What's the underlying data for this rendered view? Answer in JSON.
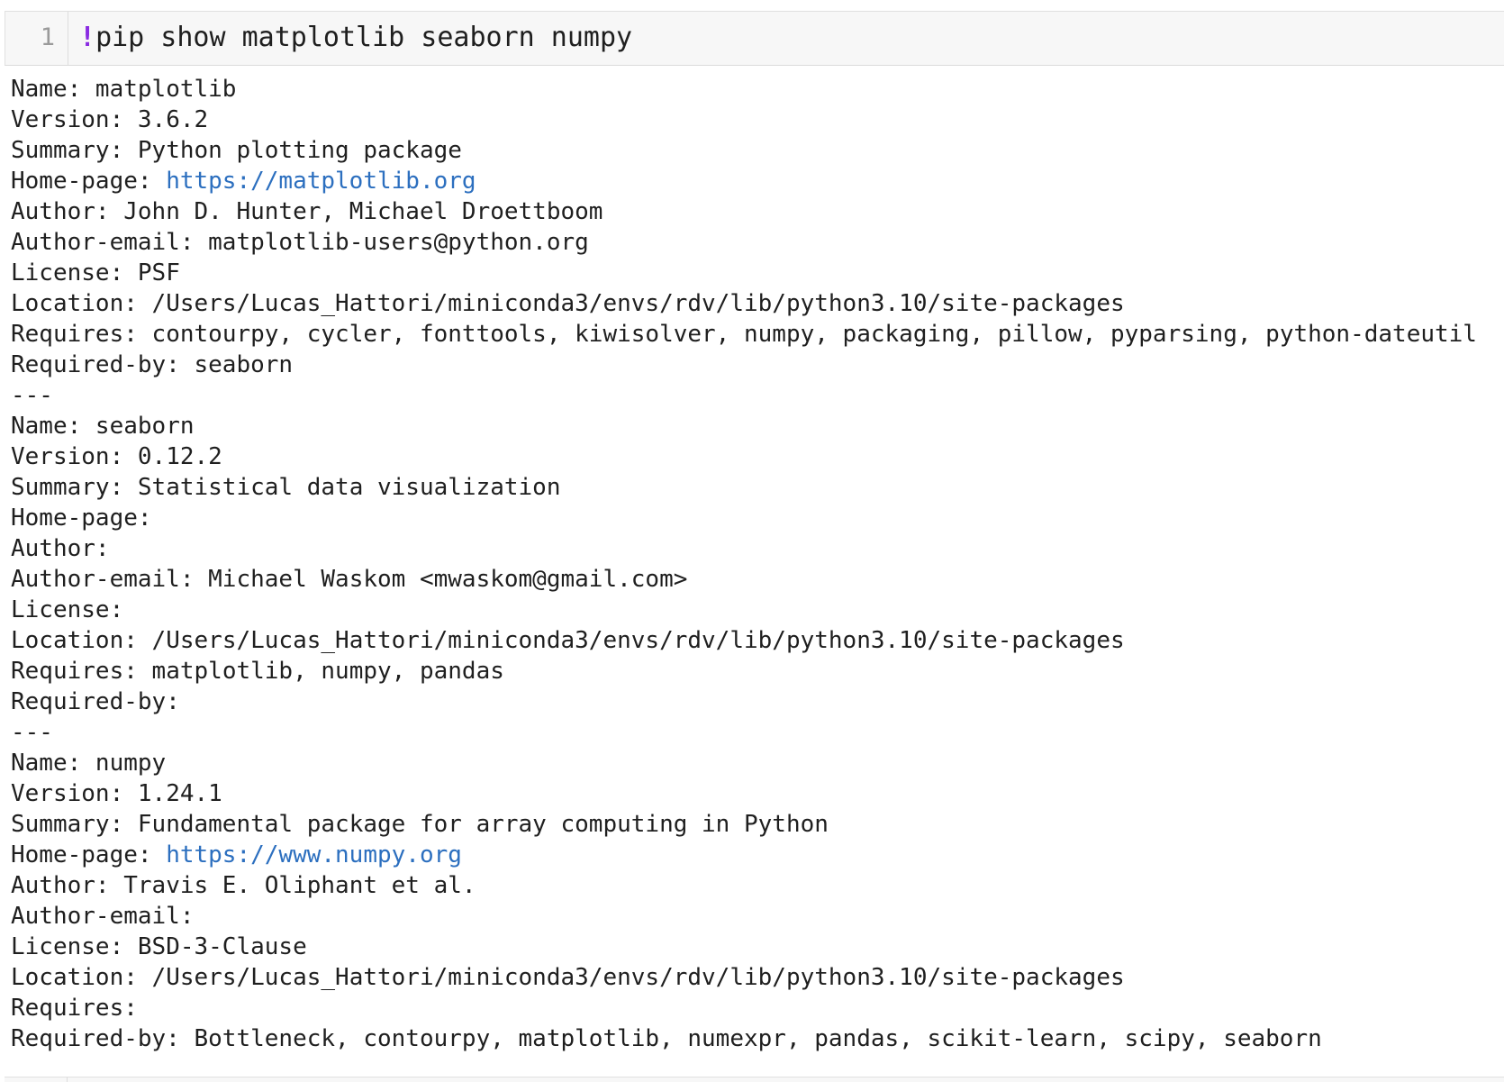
{
  "input_cell": {
    "line_number": "1",
    "bang": "!",
    "command": "pip show matplotlib seaborn numpy"
  },
  "output": {
    "lines": [
      {
        "label": "Name: ",
        "value": "matplotlib",
        "link": ""
      },
      {
        "label": "Version: ",
        "value": "3.6.2",
        "link": ""
      },
      {
        "label": "Summary: ",
        "value": "Python plotting package",
        "link": ""
      },
      {
        "label": "Home-page: ",
        "value": "",
        "link": "https://matplotlib.org"
      },
      {
        "label": "Author: ",
        "value": "John D. Hunter, Michael Droettboom",
        "link": ""
      },
      {
        "label": "Author-email: ",
        "value": "matplotlib-users@python.org",
        "link": ""
      },
      {
        "label": "License: ",
        "value": "PSF",
        "link": ""
      },
      {
        "label": "Location: ",
        "value": "/Users/Lucas_Hattori/miniconda3/envs/rdv/lib/python3.10/site-packages",
        "link": ""
      },
      {
        "label": "Requires: ",
        "value": "contourpy, cycler, fonttools, kiwisolver, numpy, packaging, pillow, pyparsing, python-dateutil",
        "link": ""
      },
      {
        "label": "Required-by: ",
        "value": "seaborn",
        "link": ""
      },
      {
        "label": "---",
        "value": "",
        "link": ""
      },
      {
        "label": "Name: ",
        "value": "seaborn",
        "link": ""
      },
      {
        "label": "Version: ",
        "value": "0.12.2",
        "link": ""
      },
      {
        "label": "Summary: ",
        "value": "Statistical data visualization",
        "link": ""
      },
      {
        "label": "Home-page:",
        "value": "",
        "link": ""
      },
      {
        "label": "Author:",
        "value": "",
        "link": ""
      },
      {
        "label": "Author-email: ",
        "value": "Michael Waskom <mwaskom@gmail.com>",
        "link": ""
      },
      {
        "label": "License:",
        "value": "",
        "link": ""
      },
      {
        "label": "Location: ",
        "value": "/Users/Lucas_Hattori/miniconda3/envs/rdv/lib/python3.10/site-packages",
        "link": ""
      },
      {
        "label": "Requires: ",
        "value": "matplotlib, numpy, pandas",
        "link": ""
      },
      {
        "label": "Required-by:",
        "value": "",
        "link": ""
      },
      {
        "label": "---",
        "value": "",
        "link": ""
      },
      {
        "label": "Name: ",
        "value": "numpy",
        "link": ""
      },
      {
        "label": "Version: ",
        "value": "1.24.1",
        "link": ""
      },
      {
        "label": "Summary: ",
        "value": "Fundamental package for array computing in Python",
        "link": ""
      },
      {
        "label": "Home-page: ",
        "value": "",
        "link": "https://www.numpy.org"
      },
      {
        "label": "Author: ",
        "value": "Travis E. Oliphant et al.",
        "link": ""
      },
      {
        "label": "Author-email:",
        "value": "",
        "link": ""
      },
      {
        "label": "License: ",
        "value": "BSD-3-Clause",
        "link": ""
      },
      {
        "label": "Location: ",
        "value": "/Users/Lucas_Hattori/miniconda3/envs/rdv/lib/python3.10/site-packages",
        "link": ""
      },
      {
        "label": "Requires:",
        "value": "",
        "link": ""
      },
      {
        "label": "Required-by: ",
        "value": "Bottleneck, contourpy, matplotlib, numexpr, pandas, scikit-learn, scipy, seaborn",
        "link": ""
      }
    ]
  },
  "colors": {
    "bang": "#8a2be2",
    "link": "#2c6fbf",
    "cell_background": "#f7f7f7",
    "text": "#1f1f1f"
  }
}
